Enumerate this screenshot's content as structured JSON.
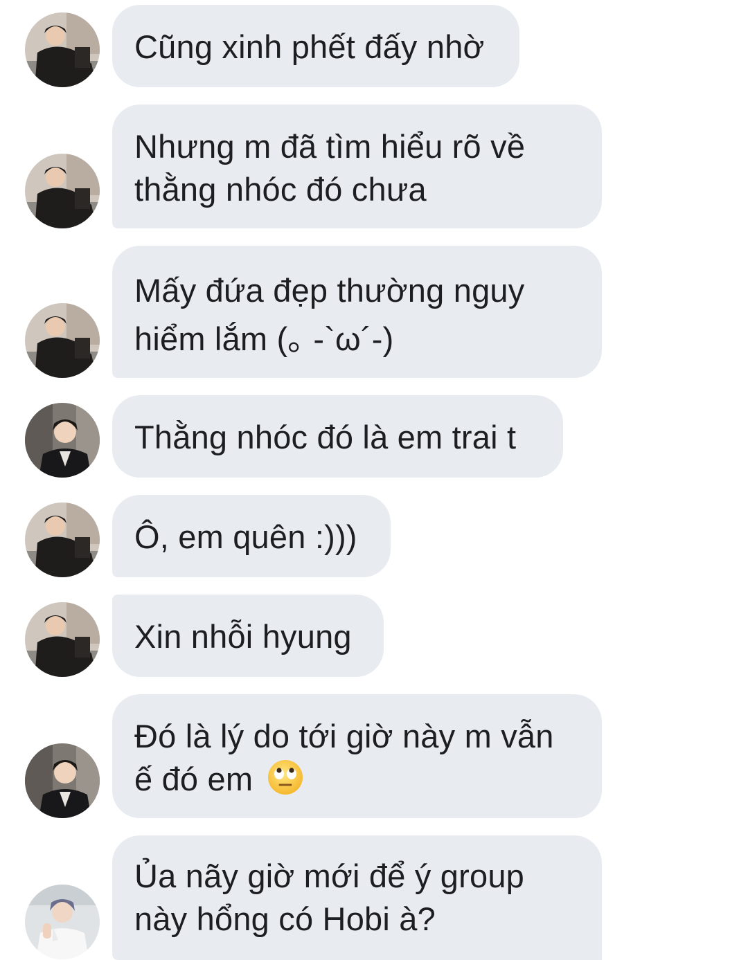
{
  "messages": [
    {
      "sender": "avatar-a",
      "text": "Cũng xinh phết đấy nhờ"
    },
    {
      "sender": "avatar-a",
      "lines": [
        "Nhưng m đã tìm hiểu rõ về",
        "thằng nhóc đó chưa"
      ]
    },
    {
      "sender": "avatar-a",
      "lines": [
        "Mấy đứa đẹp thường nguy",
        "hiểm lắm (｡ -`ω´-)"
      ]
    },
    {
      "sender": "avatar-b",
      "text": "Thằng nhóc đó là em trai t"
    },
    {
      "sender": "avatar-a",
      "text": "Ô, em quên :)))"
    },
    {
      "sender": "avatar-a",
      "text": "Xin nhỗi hyung"
    },
    {
      "sender": "avatar-b",
      "lines": [
        "Đó là lý do tới giờ này m vẫn",
        "ế đó em"
      ],
      "emoji": "face-with-rolling-eyes"
    },
    {
      "sender": "avatar-c",
      "lines": [
        "Ủa nãy giờ mới để ý group",
        "này hổng có Hobi à?"
      ]
    }
  ],
  "colors": {
    "bubble": "#e8ecf0",
    "text": "#1c1e21",
    "background": "#ffffff"
  }
}
